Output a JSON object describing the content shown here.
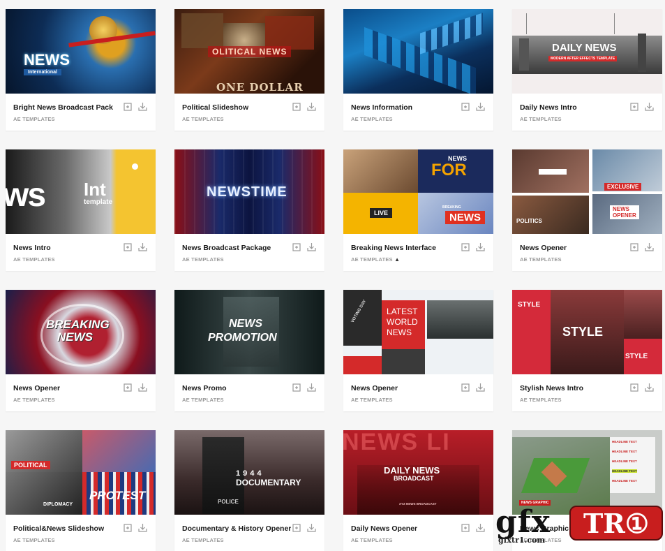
{
  "icons": {
    "collection": "add-to-collection-icon",
    "download": "download-icon"
  },
  "cards": [
    {
      "title": "Bright News Broadcast Pack",
      "category": "AE TEMPLATES",
      "thumb_text": [
        "NEWS",
        "International"
      ]
    },
    {
      "title": "Political Slideshow",
      "category": "AE TEMPLATES",
      "thumb_text": [
        "OLITICAL NEWS",
        "ONE DOLLAR"
      ]
    },
    {
      "title": "News Information",
      "category": "AE TEMPLATES",
      "thumb_text": []
    },
    {
      "title": "Daily News Intro",
      "category": "AE TEMPLATES",
      "thumb_text": [
        "DAILY NEWS",
        "MODERN AFTER EFFECTS TEMPLATE"
      ]
    },
    {
      "title": "News Intro",
      "category": "AE TEMPLATES",
      "thumb_text": [
        "ws",
        "Int",
        "template"
      ]
    },
    {
      "title": "News Broadcast Package",
      "category": "AE TEMPLATES",
      "thumb_text": [
        "NEWSTIME"
      ]
    },
    {
      "title": "Breaking News Interface",
      "category": "AE TEMPLATES",
      "thumb_text": [
        "NEWS",
        "FOR",
        "LIVE",
        "BREAKING",
        "NEWS"
      ]
    },
    {
      "title": "News Opener",
      "category": "AE TEMPLATES",
      "thumb_text": [
        "EXCLUSIVE",
        "POLITICS",
        "NEWS",
        "OPENER"
      ]
    },
    {
      "title": "News Opener",
      "category": "AE TEMPLATES",
      "thumb_text": [
        "BREAKING",
        "NEWS"
      ]
    },
    {
      "title": "News Promo",
      "category": "AE TEMPLATES",
      "thumb_text": [
        "NEWS",
        "PROMOTION"
      ]
    },
    {
      "title": "News Opener",
      "category": "AE TEMPLATES",
      "thumb_text": [
        "LATEST",
        "WORLD",
        "NEWS",
        "VOTING DAY"
      ]
    },
    {
      "title": "Stylish News Intro",
      "category": "AE TEMPLATES",
      "thumb_text": [
        "STYLE",
        "STYLE",
        "STYLE"
      ]
    },
    {
      "title": "Political&News Slideshow",
      "category": "AE TEMPLATES",
      "thumb_text": [
        "POLITICAL",
        "DIPLOMACY",
        "PROTEST"
      ]
    },
    {
      "title": "Documentary & History Opener",
      "category": "AE TEMPLATES",
      "thumb_text": [
        "1944",
        "DOCUMENTARY",
        "POLICE"
      ]
    },
    {
      "title": "Daily News Opener",
      "category": "AE TEMPLATES",
      "thumb_text": [
        "NEWS LI",
        "DAILY NEWS",
        "BROADCAST",
        "XYZ NEWS BROADCAST"
      ]
    },
    {
      "title": "News Graphic S",
      "category": "AE TEMPLATES",
      "thumb_text": [
        "HEADLINE TEXT",
        "HEADLINE TEXT",
        "HEADLINE TEXT",
        "HEADLINE TEXT",
        "HEADLINE TEXT",
        "NEWS GRAPHIC"
      ]
    }
  ],
  "watermark": {
    "brand": "gfx",
    "badge": "TR①",
    "domain": "gfxtr1.com"
  }
}
